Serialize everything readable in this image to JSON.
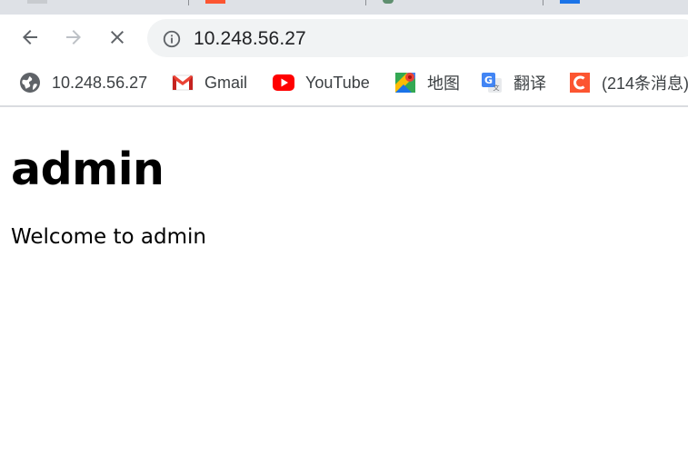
{
  "browser": {
    "address_bar": {
      "url": "10.248.56.27"
    },
    "bookmarks": [
      {
        "label": "10.248.56.27",
        "icon": "globe-icon"
      },
      {
        "label": "Gmail",
        "icon": "gmail-icon"
      },
      {
        "label": "YouTube",
        "icon": "youtube-icon"
      },
      {
        "label": "地图",
        "icon": "maps-icon"
      },
      {
        "label": "翻译",
        "icon": "translate-icon"
      },
      {
        "label": "(214条消息)",
        "icon": "csdn-icon"
      }
    ],
    "colors": {
      "youtube_red": "#ff0000",
      "csdn_orange": "#fc5531",
      "maps_green": "#34a853",
      "translate_blue": "#4285f4"
    }
  },
  "page": {
    "title": "admin",
    "text": "Welcome to admin"
  }
}
